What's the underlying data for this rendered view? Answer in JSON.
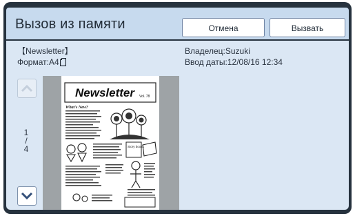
{
  "header": {
    "title": "Вызов из памяти",
    "cancel_label": "Отмена",
    "call_label": "Вызвать"
  },
  "document": {
    "name": "【Newsletter】",
    "format": "Формат:A4",
    "owner": "Владелец:Suzuki",
    "date": "Ввод даты:12/08/16 12:34"
  },
  "pager": {
    "current": "1",
    "separator": "/",
    "total": "4"
  },
  "thumbnail": {
    "headline": "Newsletter",
    "issue": "Vol. 78",
    "subhead": "What's New?",
    "box_label": "Story books"
  },
  "colors": {
    "accent": "#26323e",
    "header_bg": "#c7daee",
    "panel_bg": "#dbe7f4",
    "arrow": "#34507a"
  }
}
